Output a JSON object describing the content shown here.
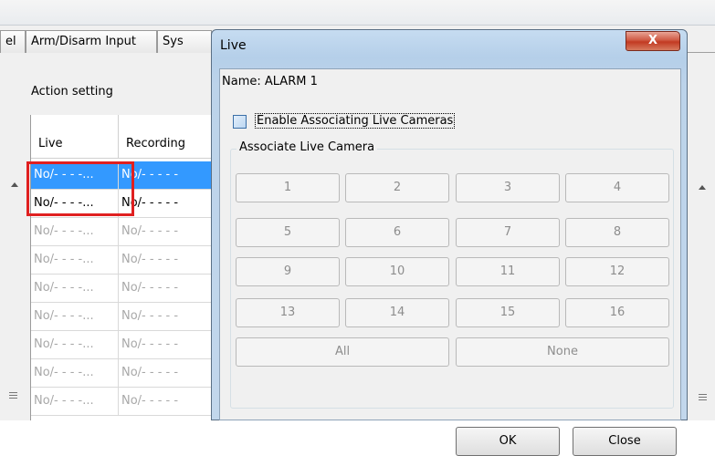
{
  "tabs": [
    {
      "label": "el"
    },
    {
      "label": "Arm/Disarm Input"
    },
    {
      "label": "Sys"
    }
  ],
  "action_setting_label": "Action setting",
  "table": {
    "columns": [
      "Live",
      "Recording"
    ],
    "rows": [
      {
        "live": "No/- - - -...",
        "recording": "No/- - - - -"
      },
      {
        "live": "No/- - - -...",
        "recording": "No/- - - - -"
      },
      {
        "live": "No/- - - -...",
        "recording": "No/- - - - -"
      },
      {
        "live": "No/- - - -...",
        "recording": "No/- - - - -"
      },
      {
        "live": "No/- - - -...",
        "recording": "No/- - - - -"
      },
      {
        "live": "No/- - - -...",
        "recording": "No/- - - - -"
      },
      {
        "live": "No/- - - -...",
        "recording": "No/- - - - -"
      }
    ]
  },
  "dialog": {
    "title": "Live",
    "close_glyph": "X",
    "name_label": "Name: ALARM  1",
    "enable_label": "Enable Associating Live Cameras",
    "enable_checked": false,
    "group_label": "Associate Live Camera",
    "cameras": [
      "1",
      "2",
      "3",
      "4",
      "5",
      "6",
      "7",
      "8",
      "9",
      "10",
      "11",
      "12",
      "13",
      "14",
      "15",
      "16"
    ],
    "all_label": "All",
    "none_label": "None",
    "ok_label": "OK",
    "close_label": "Close"
  },
  "colors": {
    "selection": "#3399ff",
    "highlight_box": "#e02020"
  }
}
